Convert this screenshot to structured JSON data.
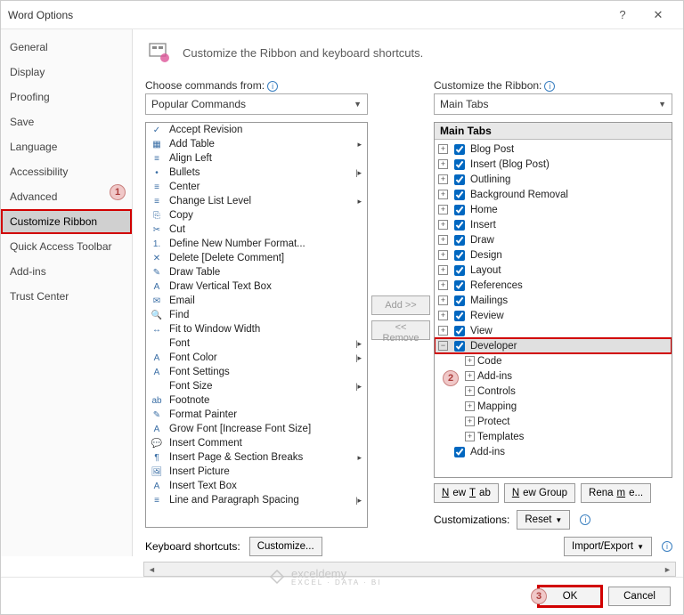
{
  "titlebar": {
    "title": "Word Options",
    "help": "?",
    "close": "✕"
  },
  "sidebar": {
    "items": [
      {
        "label": "General"
      },
      {
        "label": "Display"
      },
      {
        "label": "Proofing"
      },
      {
        "label": "Save"
      },
      {
        "label": "Language"
      },
      {
        "label": "Accessibility"
      },
      {
        "label": "Advanced"
      },
      {
        "label": "Customize Ribbon",
        "selected": true,
        "highlight": true
      },
      {
        "label": "Quick Access Toolbar"
      },
      {
        "label": "Add-ins"
      },
      {
        "label": "Trust Center"
      }
    ]
  },
  "main": {
    "heading": "Customize the Ribbon and keyboard shortcuts.",
    "left_label": "Choose commands from:",
    "left_dropdown": "Popular Commands",
    "right_label": "Customize the Ribbon:",
    "right_dropdown": "Main Tabs",
    "add_btn": "Add >>",
    "remove_btn": "<< Remove",
    "commands": [
      {
        "label": "Accept Revision",
        "icon": "✓"
      },
      {
        "label": "Add Table",
        "icon": "▦",
        "arrow": true
      },
      {
        "label": "Align Left",
        "icon": "≡"
      },
      {
        "label": "Bullets",
        "icon": "•",
        "arrow": true,
        "split": true
      },
      {
        "label": "Center",
        "icon": "≡"
      },
      {
        "label": "Change List Level",
        "icon": "≡",
        "arrow": true
      },
      {
        "label": "Copy",
        "icon": "⎘"
      },
      {
        "label": "Cut",
        "icon": "✂"
      },
      {
        "label": "Define New Number Format...",
        "icon": "1."
      },
      {
        "label": "Delete [Delete Comment]",
        "icon": "✕"
      },
      {
        "label": "Draw Table",
        "icon": "✎"
      },
      {
        "label": "Draw Vertical Text Box",
        "icon": "A"
      },
      {
        "label": "Email",
        "icon": "✉"
      },
      {
        "label": "Find",
        "icon": "🔍"
      },
      {
        "label": "Fit to Window Width",
        "icon": "↔"
      },
      {
        "label": "Font",
        "icon": "",
        "arrow": true,
        "split": true
      },
      {
        "label": "Font Color",
        "icon": "A",
        "arrow": true,
        "split": true
      },
      {
        "label": "Font Settings",
        "icon": "A"
      },
      {
        "label": "Font Size",
        "icon": "",
        "arrow": true,
        "split": true
      },
      {
        "label": "Footnote",
        "icon": "ab"
      },
      {
        "label": "Format Painter",
        "icon": "✎"
      },
      {
        "label": "Grow Font [Increase Font Size]",
        "icon": "A"
      },
      {
        "label": "Insert Comment",
        "icon": "💬"
      },
      {
        "label": "Insert Page & Section Breaks",
        "icon": "¶",
        "arrow": true
      },
      {
        "label": "Insert Picture",
        "icon": "🖼"
      },
      {
        "label": "Insert Text Box",
        "icon": "A"
      },
      {
        "label": "Line and Paragraph Spacing",
        "icon": "≡",
        "arrow": true,
        "split": true
      }
    ],
    "tree_header": "Main Tabs",
    "tabs": [
      {
        "label": "Blog Post",
        "checked": true
      },
      {
        "label": "Insert (Blog Post)",
        "checked": true
      },
      {
        "label": "Outlining",
        "checked": true
      },
      {
        "label": "Background Removal",
        "checked": true
      },
      {
        "label": "Home",
        "checked": true
      },
      {
        "label": "Insert",
        "checked": true
      },
      {
        "label": "Draw",
        "checked": true
      },
      {
        "label": "Design",
        "checked": true
      },
      {
        "label": "Layout",
        "checked": true
      },
      {
        "label": "References",
        "checked": true
      },
      {
        "label": "Mailings",
        "checked": true
      },
      {
        "label": "Review",
        "checked": true
      },
      {
        "label": "View",
        "checked": true
      }
    ],
    "developer": {
      "label": "Developer",
      "checked": true,
      "expanded": true,
      "highlight": true,
      "children": [
        "Code",
        "Add-ins",
        "Controls",
        "Mapping",
        "Protect",
        "Templates"
      ]
    },
    "addins_tail": {
      "label": "Add-ins",
      "checked": true
    },
    "new_tab": "New Tab",
    "new_group": "New Group",
    "rename": "Rename...",
    "customizations": "Customizations:",
    "reset": "Reset",
    "import_export": "Import/Export",
    "kb_label": "Keyboard shortcuts:",
    "customize": "Customize..."
  },
  "footer": {
    "ok": "OK",
    "cancel": "Cancel"
  },
  "callouts": {
    "c1": "1",
    "c2": "2",
    "c3": "3"
  },
  "watermark": {
    "brand": "exceldemy",
    "sub": "EXCEL · DATA · BI"
  }
}
